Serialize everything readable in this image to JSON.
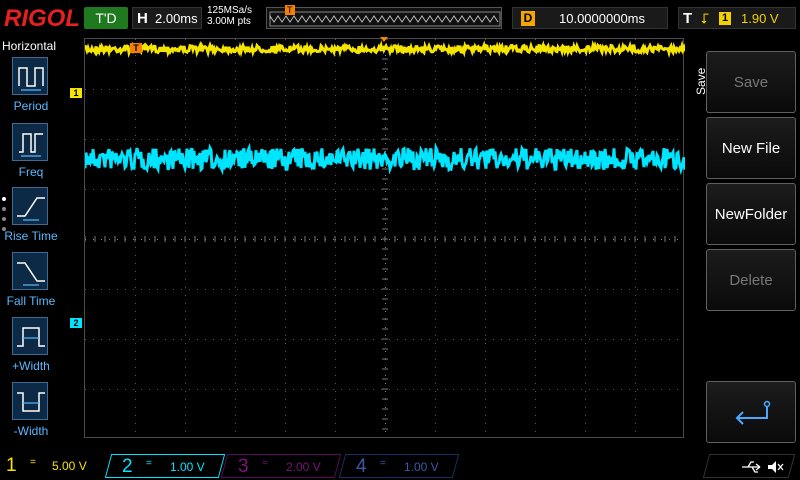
{
  "header": {
    "brand": "RIGOL",
    "run_status": "T'D",
    "horizontal_key": "H",
    "horizontal_scale": "2.00ms",
    "sample_rate": "125MSa/s",
    "memory_depth": "3.00M pts",
    "trigger_pos_marker": "T",
    "delay_key": "D",
    "delay_value": "10.0000000ms",
    "trigger_key": "T",
    "trigger_edge": "⮦",
    "trigger_source": "1",
    "trigger_level": "1.90 V"
  },
  "left_menu": {
    "title": "Horizontal",
    "items": [
      {
        "label": "Period",
        "icon": "period-icon"
      },
      {
        "label": "Freq",
        "icon": "freq-icon"
      },
      {
        "label": "Rise Time",
        "icon": "rise-time-icon"
      },
      {
        "label": "Fall Time",
        "icon": "fall-time-icon"
      },
      {
        "label": "+Width",
        "icon": "positive-width-icon"
      },
      {
        "label": "-Width",
        "icon": "negative-width-icon"
      }
    ]
  },
  "right_menu": {
    "title": "Save",
    "softkeys": [
      {
        "label": "Save",
        "enabled": false
      },
      {
        "label": "New File",
        "enabled": true
      },
      {
        "label": "NewFolder",
        "enabled": true
      },
      {
        "label": "Delete",
        "enabled": false
      },
      {
        "label": "",
        "icon": "return-icon"
      }
    ]
  },
  "channels": [
    {
      "num": "1",
      "coupling": "=",
      "scale": "5.00 V",
      "color": "#f5e400",
      "active": true
    },
    {
      "num": "2",
      "coupling": "=",
      "scale": "1.00 V",
      "color": "#00e5ff",
      "active": true
    },
    {
      "num": "3",
      "coupling": "=",
      "scale": "2.00 V",
      "color": "#c000c0",
      "active": false
    },
    {
      "num": "4",
      "coupling": "=",
      "scale": "1.00 V",
      "color": "#3a6fd8",
      "active": false
    }
  ],
  "grid_markers": {
    "ch1_label": "1",
    "ch2_label": "2",
    "trigger_T": "T"
  },
  "colors": {
    "ch1": "#f5e400",
    "ch2": "#00e5ff",
    "accent": "#f5a500",
    "menu_text": "#59b8ff"
  }
}
